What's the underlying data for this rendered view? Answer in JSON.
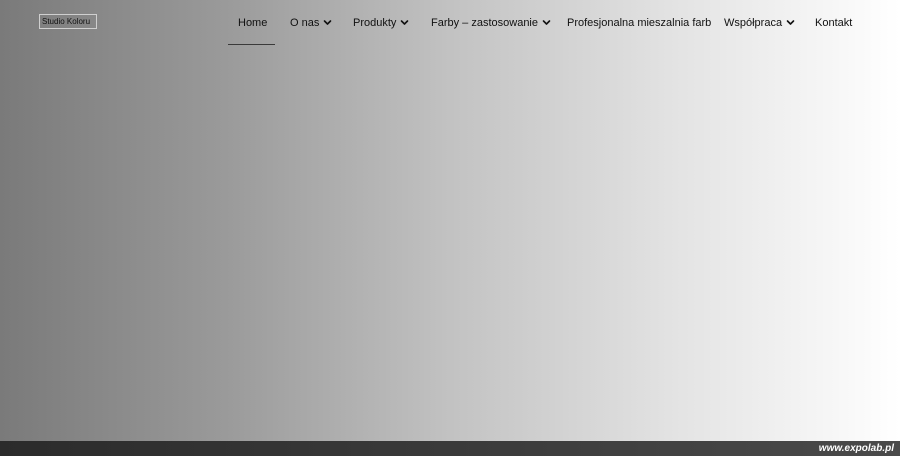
{
  "logo": {
    "text": "Studio Koloru"
  },
  "nav": {
    "items": [
      {
        "label": "Home",
        "has_dropdown": false,
        "active": true
      },
      {
        "label": "O nas",
        "has_dropdown": true,
        "active": false
      },
      {
        "label": "Produkty",
        "has_dropdown": true,
        "active": false
      },
      {
        "label": "Farby – zastosowanie",
        "has_dropdown": true,
        "active": false
      },
      {
        "label": "Profesjonalna mieszalnia farb",
        "has_dropdown": false,
        "active": false
      },
      {
        "label": "Współpraca",
        "has_dropdown": true,
        "active": false
      },
      {
        "label": "Kontakt",
        "has_dropdown": false,
        "active": false
      }
    ],
    "dropdown_icon": "chevron-down-icon"
  },
  "footer": {
    "watermark": "www.expolab.pl"
  },
  "colors": {
    "text": "#111111",
    "footer_bar": "#333333",
    "watermark_text": "#ffffff"
  }
}
